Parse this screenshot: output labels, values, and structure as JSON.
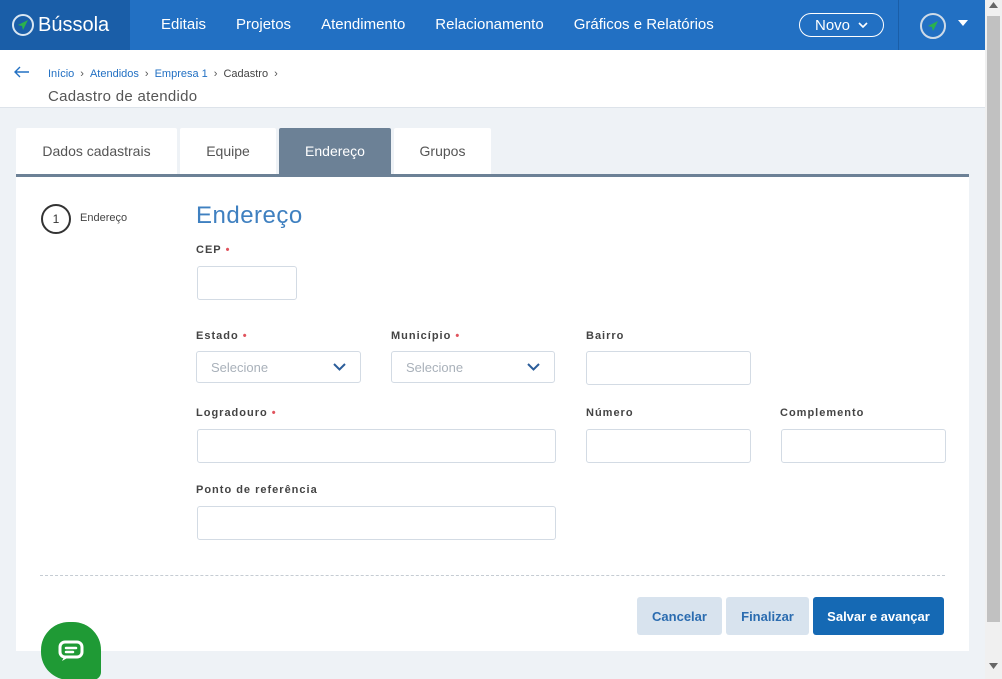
{
  "brand": {
    "name": "Bússola"
  },
  "nav": {
    "items": [
      "Editais",
      "Projetos",
      "Atendimento",
      "Relacionamento",
      "Gráficos e Relatórios"
    ],
    "new_label": "Novo"
  },
  "breadcrumb": {
    "inicio": "Início",
    "atendidos": "Atendidos",
    "empresa": "Empresa 1",
    "cadastro": "Cadastro"
  },
  "page_title": "Cadastro de atendido",
  "tabs": [
    "Dados cadastrais",
    "Equipe",
    "Endereço",
    "Grupos"
  ],
  "step": {
    "number": "1",
    "label": "Endereço"
  },
  "section_title": "Endereço",
  "form": {
    "cep": {
      "label": "CEP"
    },
    "estado": {
      "label": "Estado",
      "placeholder": "Selecione"
    },
    "municipio": {
      "label": "Município",
      "placeholder": "Selecione"
    },
    "bairro": {
      "label": "Bairro"
    },
    "logradouro": {
      "label": "Logradouro"
    },
    "numero": {
      "label": "Número"
    },
    "complemento": {
      "label": "Complemento"
    },
    "referencia": {
      "label": "Ponto de referência"
    }
  },
  "buttons": {
    "cancel": "Cancelar",
    "finish": "Finalizar",
    "save": "Salvar e avançar"
  },
  "colors": {
    "primary": "#2270c3",
    "active_tab": "#6c8196",
    "required": "#e0535d",
    "chat": "#1f9a35"
  }
}
